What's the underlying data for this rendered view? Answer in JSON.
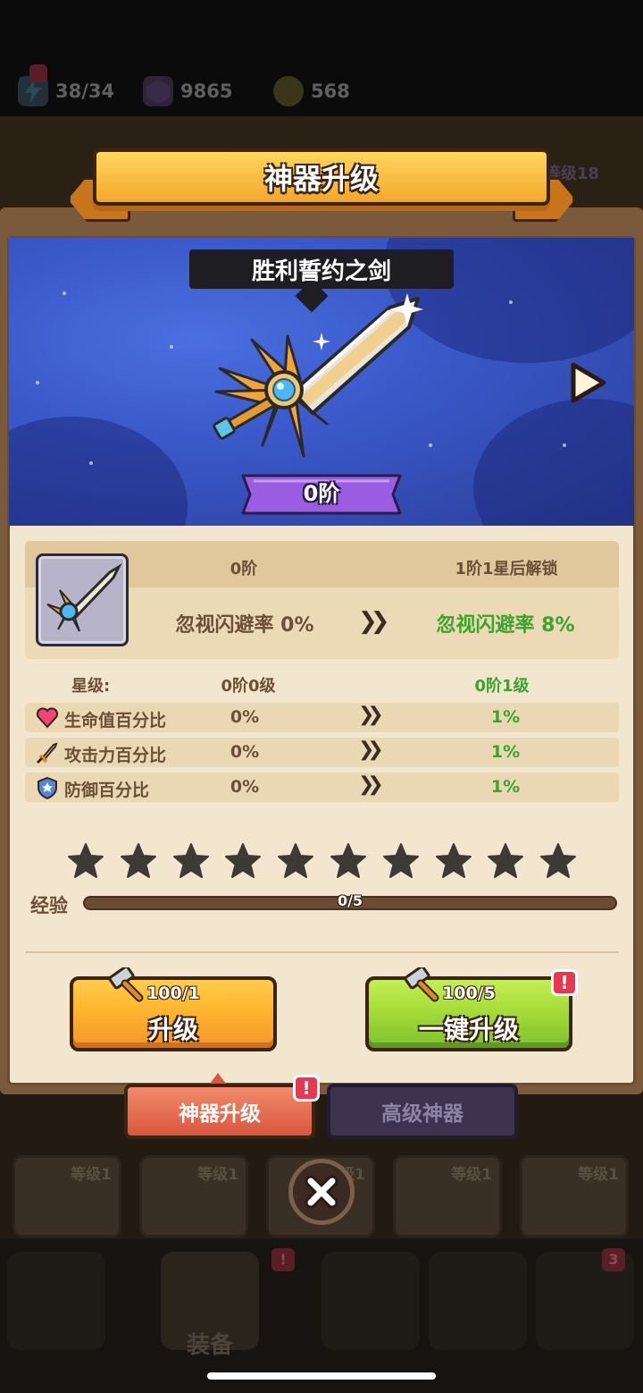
{
  "resources": {
    "energy": "38/34",
    "gems": "9865",
    "tokens": "568"
  },
  "dialog": {
    "title": "神器升级",
    "artifact_name": "胜利誓约之剑",
    "tier": "0阶"
  },
  "compare": {
    "current_tier": "0阶",
    "next_unlock": "1阶1星后解锁",
    "current_effect": "忽视闪避率 0%",
    "next_effect": "忽视闪避率 8%"
  },
  "stars": {
    "label": "星级:",
    "current": "0阶0级",
    "next": "0阶1级",
    "count": 10,
    "filled": 0
  },
  "stats": [
    {
      "icon": "heart-icon",
      "label": "生命值百分比",
      "current": "0%",
      "next": "1%"
    },
    {
      "icon": "sword-icon",
      "label": "攻击力百分比",
      "current": "0%",
      "next": "1%"
    },
    {
      "icon": "shield-icon",
      "label": "防御百分比",
      "current": "0%",
      "next": "1%"
    }
  ],
  "exp": {
    "label": "经验",
    "text": "0/5",
    "fraction": 0
  },
  "buttons": {
    "upgrade": {
      "cost": "100/1",
      "label": "升级"
    },
    "one_click": {
      "cost": "100/5",
      "label": "一键升级",
      "badge": "!"
    }
  },
  "tabs": {
    "artifact_upgrade": "神器升级",
    "advanced_artifact": "高级神器",
    "badge": "!"
  },
  "background": {
    "card_levels": [
      "等级1",
      "等级1",
      "等级1",
      "等级1",
      "等级1"
    ],
    "nav_label": "装备",
    "nav_badge": "!",
    "chest_badge": "3",
    "top_right_level": "等级18"
  },
  "colors": {
    "banner": "#f2a72c",
    "tier_ribbon": "#9a5ce0",
    "green_text": "#3aa52a",
    "orange_button": "#ffb52e",
    "green_button": "#a6dc3a",
    "active_tab": "#d9573e",
    "inactive_tab": "#3d3350",
    "badge": "#e8384f"
  }
}
